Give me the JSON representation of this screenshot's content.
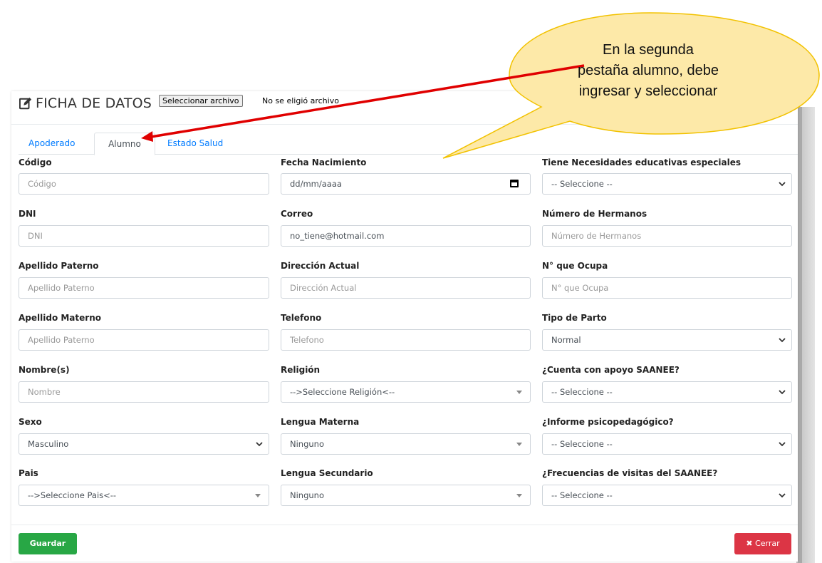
{
  "header": {
    "title": "FICHA DE DATOS",
    "file_button": "Seleccionar archivo",
    "file_status": "No se eligió archivo"
  },
  "tabs": [
    {
      "label": "Apoderado",
      "active": false
    },
    {
      "label": "Alumno",
      "active": true
    },
    {
      "label": "Estado Salud",
      "active": false
    }
  ],
  "form": {
    "col1": [
      {
        "label": "Código",
        "placeholder": "Código",
        "value": ""
      },
      {
        "label": "DNI",
        "placeholder": "DNI",
        "value": ""
      },
      {
        "label": "Apellido Paterno",
        "placeholder": "Apellido Paterno",
        "value": ""
      },
      {
        "label": "Apellido Materno",
        "placeholder": "Apellido Paterno",
        "value": ""
      },
      {
        "label": "Nombre(s)",
        "placeholder": "Nombre",
        "value": ""
      },
      {
        "label": "Sexo",
        "selected": "Masculino"
      },
      {
        "label": "Pais",
        "selected": "-->Seleccione Pais<--"
      }
    ],
    "col2": [
      {
        "label": "Fecha Nacimiento",
        "value": "dd/mm/aaaa"
      },
      {
        "label": "Correo",
        "value": "no_tiene@hotmail.com"
      },
      {
        "label": "Dirección Actual",
        "placeholder": "Dirección Actual",
        "value": ""
      },
      {
        "label": "Telefono",
        "placeholder": "Telefono",
        "value": ""
      },
      {
        "label": "Religión",
        "selected": "-->Seleccione Religión<--"
      },
      {
        "label": "Lengua Materna",
        "selected": "Ninguno"
      },
      {
        "label": "Lengua Secundario",
        "selected": "Ninguno"
      }
    ],
    "col3": [
      {
        "label": "Tiene Necesidades educativas especiales",
        "selected": "-- Seleccione --"
      },
      {
        "label": "Número de Hermanos",
        "placeholder": "Número de Hermanos",
        "value": ""
      },
      {
        "label": "N° que Ocupa",
        "placeholder": "N° que Ocupa",
        "value": ""
      },
      {
        "label": "Tipo de Parto",
        "selected": "Normal"
      },
      {
        "label": "¿Cuenta con apoyo SAANEE?",
        "selected": "-- Seleccione --"
      },
      {
        "label": "¿Informe psicopedagógico?",
        "selected": "-- Seleccione --"
      },
      {
        "label": "¿Frecuencias de visitas del SAANEE?",
        "selected": "-- Seleccione --"
      }
    ]
  },
  "footer": {
    "save_label": "Guardar",
    "close_label": "Cerrar"
  },
  "callout": {
    "line1": "En la segunda",
    "line2": "pestaña alumno, debe",
    "line3": "ingresar y seleccionar"
  },
  "colors": {
    "primary": "#007bff",
    "success": "#28a745",
    "danger": "#dc3545",
    "callout_fill": "#fde9a8",
    "callout_border": "#f2c200",
    "arrow": "#e00000"
  }
}
